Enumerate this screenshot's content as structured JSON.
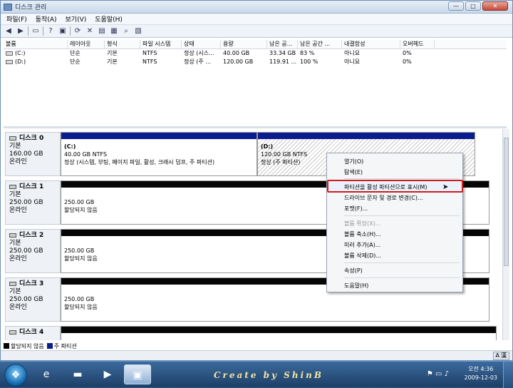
{
  "window": {
    "title": "디스크 관리",
    "btn_min": "—",
    "btn_max": "□",
    "btn_close": "✕"
  },
  "menu": [
    "파일(F)",
    "동작(A)",
    "보기(V)",
    "도움말(H)"
  ],
  "toolbar_icons": [
    "back-icon",
    "forward-icon",
    "console-icon",
    "help-icon",
    "refresh-icon",
    "delete-icon",
    "properties-icon",
    "open-icon",
    "search-icon",
    "settings-icon"
  ],
  "volume_table": {
    "headers": [
      "볼륨",
      "레이아웃",
      "형식",
      "파일 시스템",
      "상태",
      "용량",
      "남은 공...",
      "남은 공간 ...",
      "내결함성",
      "오버헤드"
    ],
    "rows": [
      [
        "(C:)",
        "단순",
        "기본",
        "NTFS",
        "정상 (시스...",
        "40.00 GB",
        "33.34 GB",
        "83 %",
        "아니요",
        "0%"
      ],
      [
        "(D:)",
        "단순",
        "기본",
        "NTFS",
        "정상 (주 ...",
        "120.00 GB",
        "119.91 ...",
        "100 %",
        "아니요",
        "0%"
      ]
    ]
  },
  "disks": [
    {
      "name": "디스크 0",
      "type": "기본",
      "size": "160.00 GB",
      "status": "온라인",
      "partitions": [
        {
          "title": "(C:)",
          "line1": "40.00 GB NTFS",
          "line2": "정상 (시스템, 부팅, 페이지 파일, 활성, 크래시 덤프, 주 파티션)"
        },
        {
          "title": "(D:)",
          "line1": "120.00 GB NTFS",
          "line2": "정상 (주 파티션)"
        }
      ]
    },
    {
      "name": "디스크 1",
      "type": "기본",
      "size": "250.00 GB",
      "status": "온라인",
      "partitions": [
        {
          "line1": "250.00 GB",
          "line2": "할당되지 않음"
        }
      ]
    },
    {
      "name": "디스크 2",
      "type": "기본",
      "size": "250.00 GB",
      "status": "온라인",
      "partitions": [
        {
          "line1": "250.00 GB",
          "line2": "할당되지 않음"
        }
      ]
    },
    {
      "name": "디스크 3",
      "type": "기본",
      "size": "250.00 GB",
      "status": "온라인",
      "partitions": [
        {
          "line1": "250.00 GB",
          "line2": "할당되지 않음"
        }
      ]
    },
    {
      "name": "디스크 4"
    }
  ],
  "legend": {
    "unallocated": "할당되지 않음",
    "primary": "주 파티션"
  },
  "context_menu": {
    "items": [
      "열기(O)",
      "탐색(E)",
      "파티션을 활성 파티션으로 표시(M)",
      "드라이브 문자 및 경로 변경(C)...",
      "포맷(F)...",
      "볼륨 확장(X)...",
      "볼륨 축소(H)...",
      "미러 추가(A)...",
      "볼륨 삭제(D)...",
      "속성(P)",
      "도움말(H)"
    ],
    "highlighted": "파티션을 활성 파티션으로 표시(M)",
    "disabled": [
      "볼륨 확장(X)..."
    ]
  },
  "status_ime": [
    "A",
    "漢"
  ],
  "taskbar": {
    "credit": "Create by ShinB",
    "time": "오전 4:36",
    "date": "2009-12-03"
  },
  "colors": {
    "primary_partition": "#0b1c8e",
    "unallocated": "#050505",
    "highlight_border": "#d01a20"
  }
}
